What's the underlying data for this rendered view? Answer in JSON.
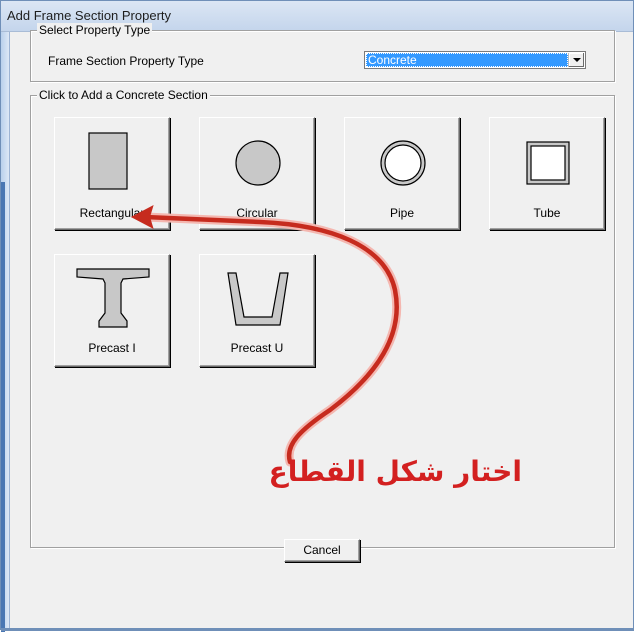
{
  "window": {
    "title": "Add Frame Section Property"
  },
  "select_property_type": {
    "group_label": "Select Property Type",
    "field_label": "Frame Section Property Type",
    "selected_value": "Concrete"
  },
  "concrete_section": {
    "group_label": "Click to Add a Concrete Section",
    "buttons": [
      {
        "label": "Rectangular",
        "icon": "rectangle-section-icon"
      },
      {
        "label": "Circular",
        "icon": "circle-section-icon"
      },
      {
        "label": "Pipe",
        "icon": "pipe-section-icon"
      },
      {
        "label": "Tube",
        "icon": "tube-section-icon"
      },
      {
        "label": "Precast I",
        "icon": "precast-i-section-icon"
      },
      {
        "label": "Precast U",
        "icon": "precast-u-section-icon"
      }
    ]
  },
  "footer": {
    "cancel_label": "Cancel"
  },
  "annotation": {
    "text": "اختار شكل القطاع",
    "color": "#d32020"
  },
  "colors": {
    "selection": "#3399ff",
    "shape_fill": "#c8c8c8",
    "annotation_arrow": "#c62b1e"
  }
}
